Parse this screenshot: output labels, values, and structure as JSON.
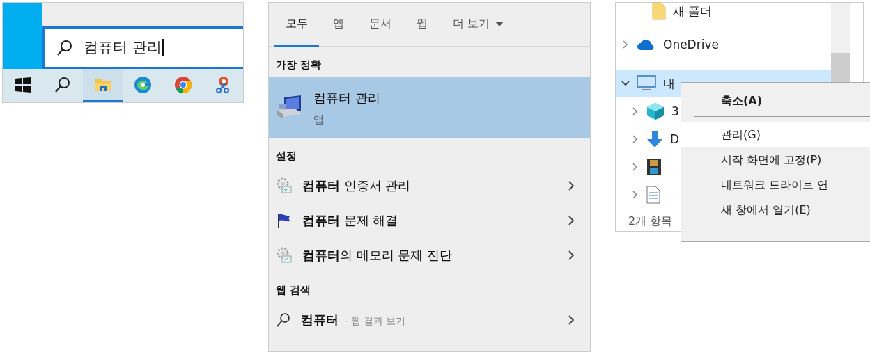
{
  "taskbar_search": {
    "value": "컴퓨터 관리"
  },
  "taskbar": [
    {
      "kind": "start",
      "selected": false
    },
    {
      "kind": "search",
      "selected": false
    },
    {
      "kind": "explorer",
      "selected": true
    },
    {
      "kind": "edge",
      "selected": false
    },
    {
      "kind": "chrome",
      "selected": false
    },
    {
      "kind": "app",
      "selected": false
    }
  ],
  "search_panel": {
    "tabs": [
      {
        "label": "모두",
        "selected": true
      },
      {
        "label": "앱",
        "selected": false
      },
      {
        "label": "문서",
        "selected": false
      },
      {
        "label": "웹",
        "selected": false
      },
      {
        "label": "더 보기",
        "selected": false,
        "dropdown": true
      }
    ],
    "sections": [
      {
        "heading": "가장 정확",
        "items": [
          {
            "kind": "app",
            "title": "컴퓨터 관리",
            "subtitle": "앱",
            "selected": true
          }
        ]
      },
      {
        "heading": "설정",
        "items": [
          {
            "kind": "gear",
            "title": "**컴퓨터** 인증서 관리",
            "selected": false
          },
          {
            "kind": "flag",
            "title": "**컴퓨터** 문제 해결",
            "selected": false
          },
          {
            "kind": "gear",
            "title": "**컴퓨터**의 메모리 문제 진단",
            "selected": false
          }
        ]
      },
      {
        "heading": "웹 검색",
        "items": [
          {
            "kind": "web",
            "title": "컴퓨터",
            "hint": "- 웹 결과 보기",
            "selected": false
          }
        ]
      }
    ]
  },
  "explorer": {
    "tree": [
      {
        "kind": "folder",
        "label": "새 폴더",
        "selected": false
      },
      {
        "kind": "cloud",
        "label": "OneDrive",
        "expanded": false,
        "selected": false
      },
      {
        "kind": "pc",
        "label": "내",
        "expanded": true,
        "selected": true,
        "children": [
          {
            "kind": "cube",
            "label": "3",
            "expanded": false,
            "selected": false
          },
          {
            "kind": "download",
            "label": "D",
            "expanded": false,
            "selected": false
          },
          {
            "kind": "video",
            "expanded": false,
            "selected": false
          },
          {
            "kind": "document",
            "expanded": false,
            "selected": false
          }
        ]
      }
    ],
    "status": "2개 항목",
    "context_menu": [
      {
        "label": "축소(A)",
        "bold": true,
        "separator_after": true,
        "selected": false
      },
      {
        "label": "관리(G)",
        "bold": false,
        "selected": true
      },
      {
        "label": "시작 화면에 고정(P)",
        "bold": false,
        "selected": false
      },
      {
        "label": "네트워크 드라이브 연",
        "bold": false,
        "selected": false
      },
      {
        "label": "새 창에서 열기(E)",
        "bold": false,
        "selected": false
      }
    ]
  }
}
